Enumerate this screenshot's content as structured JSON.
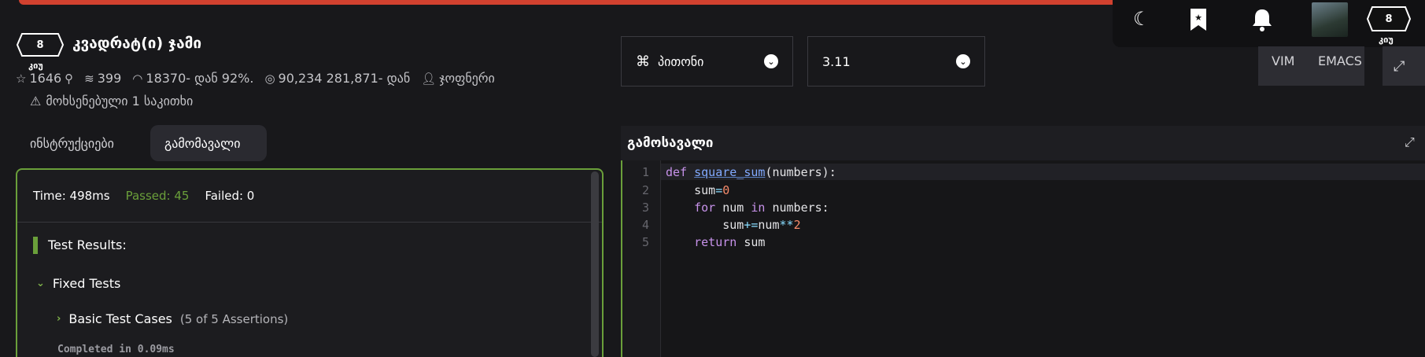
{
  "nav": {
    "avatar_alt": "avatar",
    "rank_label": "8",
    "rank_sub": "კიუ"
  },
  "kata": {
    "rank": "8",
    "rank_sub": "კიუ",
    "title": "კვადრატ(ი) ჯამი",
    "stats": {
      "stars": "1646",
      "collections": "399",
      "completion": "18370- დან 92%.",
      "solutions": "90,234 281,871- დან",
      "author": "ჯოფნერი"
    },
    "issues": "მოხსენებული 1 საკითხი"
  },
  "tabs": {
    "instructions": "ინსტრუქციები",
    "output": "გამომავალი"
  },
  "results": {
    "time": "Time: 498ms",
    "passed": "Passed: 45",
    "failed": "Failed: 0",
    "test_results": "Test Results:",
    "fixed_tests": "Fixed Tests",
    "basic_cases": "Basic Test Cases",
    "basic_cases_sub": "(5 of 5 Assertions)",
    "completed": "Completed in 0.09ms"
  },
  "language": {
    "value": "პითონი"
  },
  "version": {
    "value": "3.11"
  },
  "keybindings": {
    "vim": "VIM",
    "emacs": "EMACS"
  },
  "solution": {
    "title": "გამოსავალი"
  },
  "code": {
    "line_numbers": [
      "1",
      "2",
      "3",
      "4",
      "5"
    ],
    "l1_def": "def",
    "l1_fn": "square_sum",
    "l1_rest": "(numbers):",
    "l2_a": "sum",
    "l2_op": "=",
    "l2_num": "0",
    "l3_for": "for",
    "l3_a": " num ",
    "l3_in": "in",
    "l3_b": " numbers:",
    "l4_a": "sum",
    "l4_op": "+=",
    "l4_b": "num",
    "l4_op2": "**",
    "l4_num": "2",
    "l5_ret": "return",
    "l5_b": " sum"
  },
  "colors": {
    "accent_red": "#d1412f",
    "passed_green": "#6a9f3a"
  }
}
